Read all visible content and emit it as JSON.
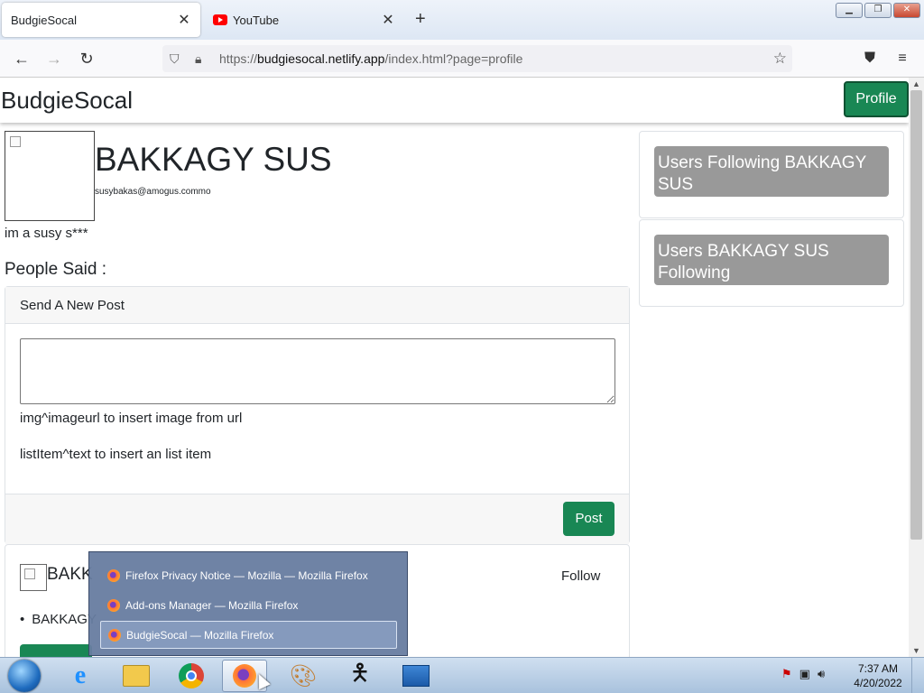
{
  "browser": {
    "tabs": [
      {
        "title": "BudgieSocal",
        "active": true
      },
      {
        "title": "YouTube",
        "active": false
      }
    ],
    "url": {
      "prefix": "https://",
      "host": "budgiesocal.netlify.app",
      "path": "/index.html?page=profile"
    }
  },
  "site": {
    "brand": "BudgieSocal",
    "profile_button": "Profile"
  },
  "profile": {
    "name": "BAKKAGY SUS",
    "email": "susybakas@amogus.commo",
    "bio": "im a susy s***",
    "people_said": "People Said :"
  },
  "new_post": {
    "header": "Send A New Post",
    "textarea_value": "",
    "hint_image": "img^imageurl to insert image from url",
    "hint_list": "listItem^text to insert an list item",
    "post_button": "Post"
  },
  "feed": {
    "author": "BAKK",
    "follow": "Follow",
    "list_item": "BAKKAGY"
  },
  "sidebar": {
    "followers_button": "Users Following BAKKAGY SUS",
    "following_button": "Users BAKKAGY SUS Following"
  },
  "taskbar_popup": {
    "items": [
      "Firefox Privacy Notice — Mozilla — Mozilla Firefox",
      "Add-ons Manager — Mozilla Firefox",
      "BudgieSocal — Mozilla Firefox"
    ],
    "selected_index": 2
  },
  "clock": {
    "time": "7:37 AM",
    "date": "4/20/2022"
  },
  "colors": {
    "success_green": "#198754",
    "grey_button": "#999999",
    "popup_bg": "#677ca0"
  }
}
